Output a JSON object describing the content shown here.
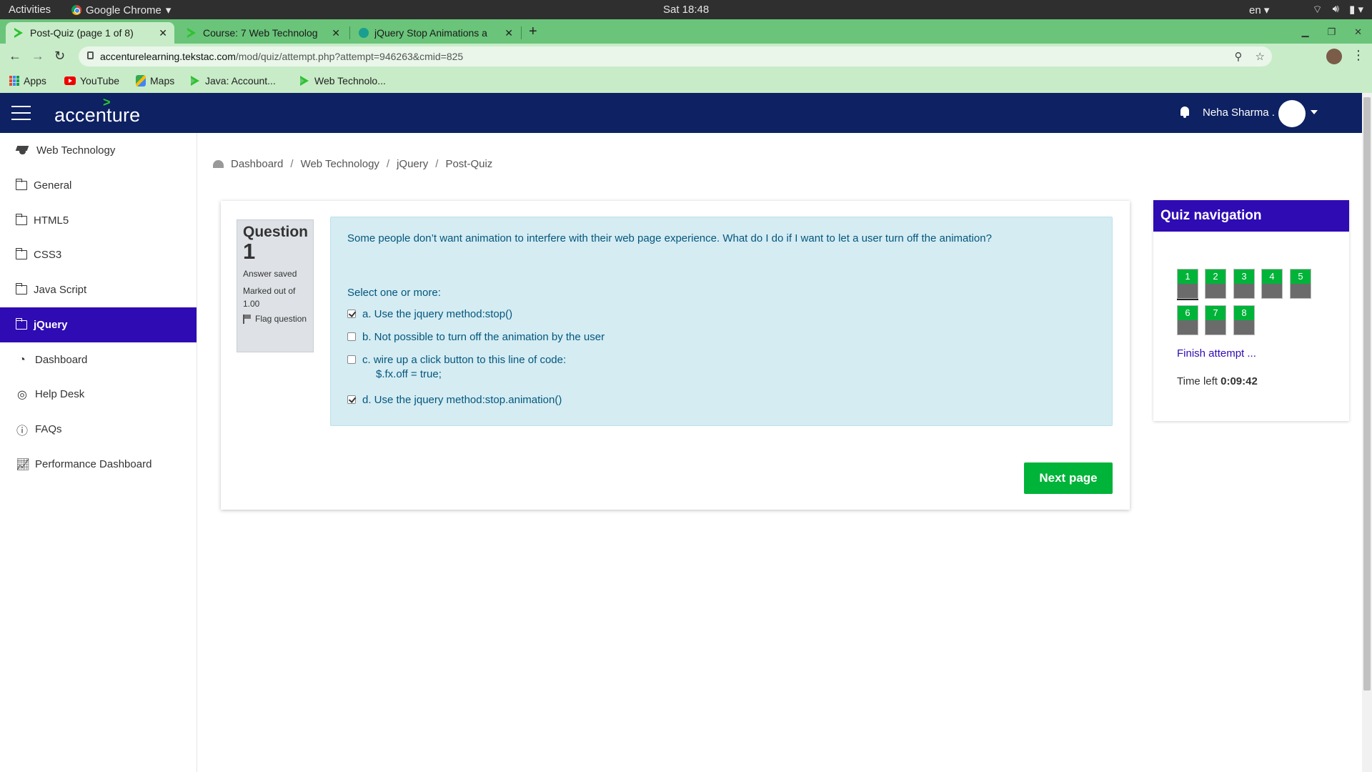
{
  "os_bar": {
    "activities": "Activities",
    "app_name": "Google Chrome",
    "clock": "Sat 18:48",
    "lang": "en"
  },
  "browser": {
    "tabs": [
      {
        "title": "Post-Quiz (page 1 of 8)",
        "active": true
      },
      {
        "title": "Course: 7 Web Technolog",
        "active": false
      },
      {
        "title": "jQuery Stop Animations a",
        "active": false
      }
    ],
    "url_host": "accenturelearning.tekstac.com",
    "url_path": "/mod/quiz/attempt.php?attempt=946263&cmid=825",
    "bookmarks": [
      "Apps",
      "YouTube",
      "Maps",
      "Java: Account...",
      "Web Technolo..."
    ]
  },
  "header": {
    "logo": "accenture",
    "user_name": "Neha Sharma ."
  },
  "sidebar": {
    "items": [
      {
        "label": "Web Technology",
        "icon": "graduation-cap-icon",
        "active": false
      },
      {
        "label": "General",
        "icon": "folder-icon",
        "active": false
      },
      {
        "label": "HTML5",
        "icon": "folder-icon",
        "active": false
      },
      {
        "label": "CSS3",
        "icon": "folder-icon",
        "active": false
      },
      {
        "label": "Java Script",
        "icon": "folder-icon",
        "active": false
      },
      {
        "label": "jQuery",
        "icon": "folder-icon",
        "active": true
      },
      {
        "label": "Dashboard",
        "icon": "dashboard-icon",
        "active": false
      },
      {
        "label": "Help Desk",
        "icon": "lifebuoy-icon",
        "active": false
      },
      {
        "label": "FAQs",
        "icon": "question-circle-icon",
        "active": false
      },
      {
        "label": "Performance Dashboard",
        "icon": "line-chart-icon",
        "active": false
      }
    ]
  },
  "breadcrumb": [
    "Dashboard",
    "Web Technology",
    "jQuery",
    "Post-Quiz"
  ],
  "question": {
    "label": "Question",
    "number": "1",
    "status": "Answer saved",
    "marked_out_of": "Marked out of 1.00",
    "flag": "Flag question",
    "text": "Some people don’t want animation to interfere with their web page experience. What do I do if I want to let a user turn off the animation?",
    "prompt": "Select one or more:",
    "options": [
      {
        "label": "a. Use the jquery method:stop()",
        "checked": true
      },
      {
        "label": "b. Not possible to turn off the animation by the user",
        "checked": false
      },
      {
        "label": "c. wire up a click button to this line of code:",
        "code": "$.fx.off = true;",
        "checked": false
      },
      {
        "label": "d. Use the jquery method:stop.animation()",
        "checked": true
      }
    ],
    "next_button": "Next page"
  },
  "quiz_nav": {
    "title": "Quiz navigation",
    "buttons": [
      "1",
      "2",
      "3",
      "4",
      "5",
      "6",
      "7",
      "8"
    ],
    "current": "1",
    "finish": "Finish attempt ...",
    "time_label": "Time left",
    "time_value": "0:09:42"
  },
  "colors": {
    "brand_navy": "#0d2163",
    "accent_purple": "#2f0bb3",
    "success_green": "#00b339",
    "question_bg": "#d4ecf2"
  }
}
